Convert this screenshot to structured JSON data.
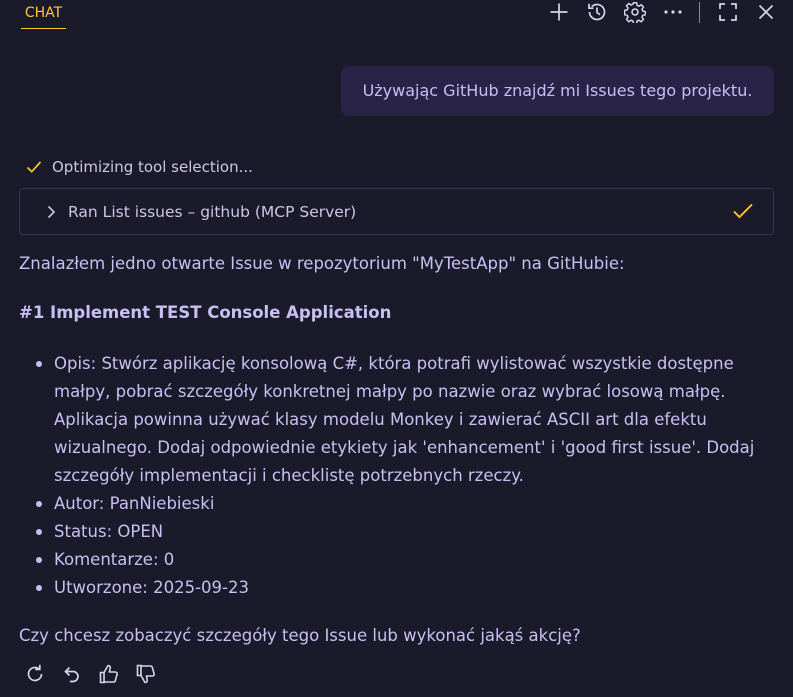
{
  "header": {
    "tab_label": "CHAT",
    "icons": [
      "plus-icon",
      "history-icon",
      "gear-icon",
      "more-icon",
      "maximize-icon",
      "close-icon"
    ]
  },
  "user_message": "Używając GitHub znajdź mi Issues tego projektu.",
  "progress": {
    "text": "Optimizing tool selection..."
  },
  "tool_call": {
    "label": "Ran List issues – github (MCP Server)",
    "status_icon": "check-icon"
  },
  "response": {
    "intro": "Znalazłem jedno otwarte Issue w repozytorium \"MyTestApp\" na GitHubie:",
    "issue_title": "#1 Implement TEST Console Application",
    "description_lines": [
      "Opis: Stwórz aplikację konsolową C#, która potrafi wylistować wszystkie dostępne",
      "małpy, pobrać szczegóły konkretnej małpy po nazwie oraz wybrać losową małpę.",
      "Aplikacja powinna używać klasy modelu Monkey i zawierać ASCII art dla efektu",
      "wizualnego. Dodaj odpowiednie etykiety jak 'enhancement' i 'good first issue'. Dodaj",
      "szczegóły implementacji i checklistę potrzebnych rzeczy."
    ],
    "author": "Autor: PanNiebieski",
    "status": "Status: OPEN",
    "comments": "Komentarze: 0",
    "created": "Utworzone: 2025-09-23",
    "question": "Czy chcesz zobaczyć szczegóły tego Issue lub wykonać jakąś akcję?"
  },
  "actions": [
    "retry-icon",
    "undo-icon",
    "thumbs-up-icon",
    "thumbs-down-icon"
  ],
  "colors": {
    "background": "#1b1a2b",
    "accent": "#ffc92a",
    "text": "#c8bff2",
    "user_bubble": "#2a2348"
  }
}
